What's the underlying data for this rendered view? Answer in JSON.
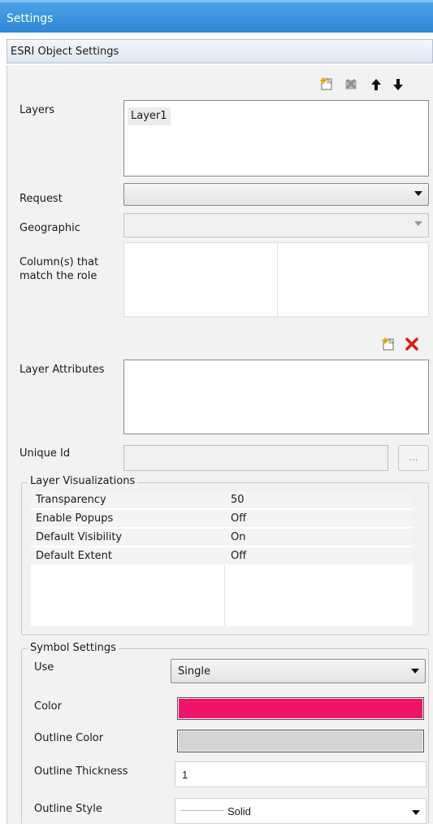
{
  "window": {
    "title": "Settings"
  },
  "section": {
    "title": "ESRI Object Settings"
  },
  "layers": {
    "label": "Layers",
    "items": [
      "Layer1"
    ],
    "toolbar": {
      "add_icon": "new-layer-icon",
      "delete_icon": "delete-layer-icon",
      "up_icon": "move-up-icon",
      "down_icon": "move-down-icon"
    }
  },
  "request": {
    "label": "Request",
    "value": ""
  },
  "geographic": {
    "label": "Geographic",
    "value": ""
  },
  "columns_role": {
    "label_line1": "Column(s) that",
    "label_line2": "match the role"
  },
  "layer_attributes": {
    "label": "Layer Attributes",
    "toolbar": {
      "add_icon": "new-attribute-icon",
      "delete_icon": "delete-attribute-icon"
    }
  },
  "unique_id": {
    "label": "Unique Id",
    "value": "",
    "browse_label": "..."
  },
  "visualizations": {
    "title": "Layer Visualizations",
    "rows": [
      {
        "name": "Transparency",
        "value": "50"
      },
      {
        "name": "Enable Popups",
        "value": "Off"
      },
      {
        "name": "Default Visibility",
        "value": "On"
      },
      {
        "name": "Default Extent",
        "value": "Off"
      }
    ]
  },
  "symbol": {
    "title": "Symbol Settings",
    "use_label": "Use",
    "use_value": "Single",
    "color_label": "Color",
    "color_value": "#f0136b",
    "outline_color_label": "Outline Color",
    "outline_color_value": "#d4d4d4",
    "outline_thickness_label": "Outline Thickness",
    "outline_thickness_value": "1",
    "outline_style_label": "Outline Style",
    "outline_style_value": "Solid"
  }
}
